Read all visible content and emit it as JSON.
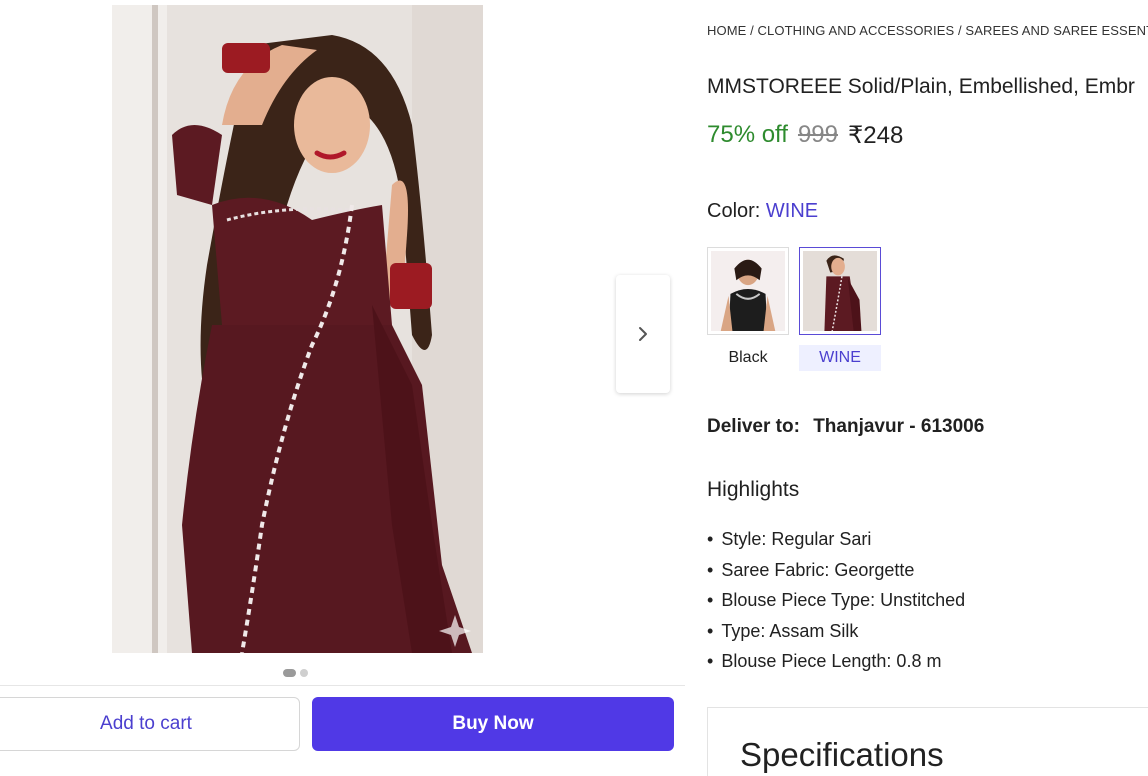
{
  "gallery": {
    "next_icon": "chevron-right-icon",
    "dots": [
      true,
      false
    ]
  },
  "actions": {
    "add_to_cart": "Add to cart",
    "buy_now": "Buy Now"
  },
  "breadcrumb": {
    "items": [
      "HOME",
      "CLOTHING AND ACCESSORIES",
      "SAREES AND SAREE ESSENT"
    ],
    "separator": " / "
  },
  "product": {
    "title": "MMSTOREEE Solid/Plain, Embellished, Embr",
    "discount": "75% off",
    "mrp": "999",
    "price": "₹248"
  },
  "color": {
    "label": "Color:",
    "value": "WINE",
    "options": [
      {
        "name": "Black",
        "selected": false
      },
      {
        "name": "WINE",
        "selected": true
      }
    ]
  },
  "delivery": {
    "label": "Deliver to:",
    "location": "Thanjavur - 613006"
  },
  "highlights": {
    "title": "Highlights",
    "items": [
      "Style: Regular Sari",
      "Saree Fabric: Georgette",
      "Blouse Piece Type: Unstitched",
      "Type: Assam Silk",
      "Blouse Piece Length: 0.8 m"
    ]
  },
  "specifications": {
    "title": "Specifications"
  },
  "colors": {
    "accent": "#5039e6",
    "link": "#4b3fcf",
    "discount": "#2e8b2e",
    "saree": "#5c1a22"
  }
}
